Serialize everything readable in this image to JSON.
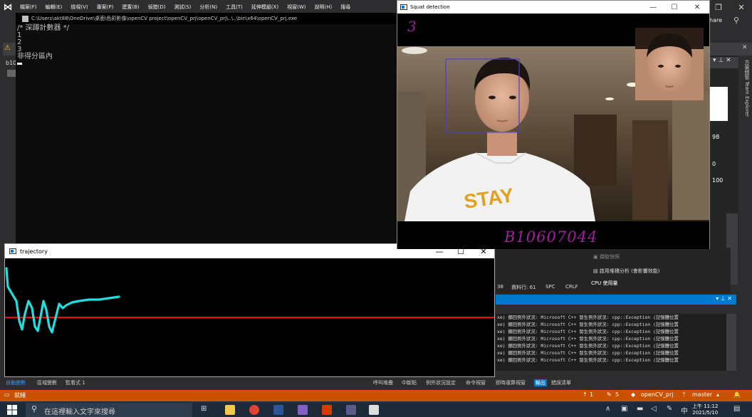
{
  "vs": {
    "menu": [
      "檔案(F)",
      "編輯(E)",
      "檢視(V)",
      "專案(P)",
      "建置(B)",
      "偵錯(D)",
      "測試(S)",
      "分析(N)",
      "工具(T)",
      "延伸模組(X)",
      "視窗(W)",
      "說明(H)",
      "搜尋"
    ],
    "share_label": "hare",
    "tab_prefix": "b10",
    "right_panel": {
      "num_98": "98",
      "num_0": "0",
      "num_100": "100"
    },
    "vertical_tabs": "方案總管  Team Explorer",
    "diagnostics": {
      "snapshot": "擷取快照",
      "heap": "啟用堆積分析 (會影響效能)",
      "cpu": "CPU 使用量"
    },
    "editor_status": {
      "col": "38",
      "row": "資料行: 61",
      "spc": "SPC",
      "crlf": "CRLF"
    },
    "output_lines": [
      "xe) 擲回例外狀況: Microsoft C++ 發生例外狀況: cpp::Exception (記憶體位置",
      "xe) 擲回例外狀況: Microsoft C++ 發生例外狀況: cpp::Exception (記憶體位置",
      "xe) 擲回例外狀況: Microsoft C++ 發生例外狀況: cpp::Exception (記憶體位置",
      "xe) 擲回例外狀況: Microsoft C++ 發生例外狀況: cpp::Exception (記憶體位置",
      "xe) 擲回例外狀況: Microsoft C++ 發生例外狀況: cpp::Exception (記憶體位置",
      "xe) 擲回例外狀況: Microsoft C++ 發生例外狀況: cpp::Exception (記憶體位置",
      "xe) 擲回例外狀況: Microsoft C++ 發生例外狀況: cpp::Exception (記憶體位置"
    ],
    "bottom_tabs_left": [
      "自動變數",
      "區域變數",
      "監看式 1"
    ],
    "bottom_tabs_right": [
      "呼叫堆疊",
      "中斷點",
      "例外狀況設定",
      "命令視窗",
      "即時運算視窗",
      "輸出",
      "錯誤清單"
    ],
    "status": {
      "ready": "就緒",
      "up": "1",
      "edits": "5",
      "project": "openCV_prj",
      "branch": "master"
    },
    "accent": "#ca5100"
  },
  "console": {
    "title": "C:\\Users\\akt88\\OneDrive\\桌面\\色彩影像\\openCV project\\openCV_prj\\openCV_prj\\..\\..\\bin\\x64\\openCV_prj.exe",
    "lines": [
      "/* 深蹲計數器 */",
      "1",
      "2",
      "3",
      "非得分區內"
    ]
  },
  "trajectory": {
    "title": "trajectory",
    "line_color": "#ff0000",
    "curve_color": "#1fe0e0"
  },
  "squat": {
    "title": "Squat detection",
    "count": "3",
    "student_id": "B10607044",
    "text_color": "#a020a0"
  },
  "taskbar": {
    "search_placeholder": "在這裡輸入文字來搜尋",
    "time": "上午 11:12",
    "date": "2021/5/10",
    "ime": "中"
  }
}
